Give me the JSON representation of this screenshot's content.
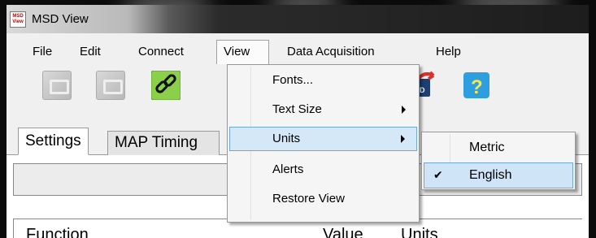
{
  "window": {
    "title": "MSD View",
    "app_icon_text": "MSD View"
  },
  "menubar": [
    "File",
    "Edit",
    "Connect",
    "View",
    "Data Acquisition",
    "Help"
  ],
  "toolbar": {
    "buttons": [
      {
        "icon": "disabled-import-icon",
        "enabled": false
      },
      {
        "icon": "disabled-export-icon",
        "enabled": false
      },
      {
        "icon": "connect-link-icon",
        "enabled": true
      },
      {
        "icon": "msd-send-icon",
        "enabled": true
      },
      {
        "icon": "help-question-icon",
        "enabled": true
      }
    ],
    "msd_badge": "SD",
    "help_glyph": "?"
  },
  "tabs": [
    "Settings",
    "MAP Timing"
  ],
  "grid_columns": [
    "Function",
    "Value",
    "Units"
  ],
  "view_menu": [
    {
      "label": "Fonts...",
      "submenu": false
    },
    {
      "label": "Text Size",
      "submenu": true
    },
    {
      "label": "Units",
      "submenu": true,
      "highlighted": true
    },
    {
      "label": "Alerts",
      "submenu": false
    },
    {
      "label": "Restore View",
      "submenu": false
    }
  ],
  "units_menu": [
    {
      "label": "Metric",
      "checked": false
    },
    {
      "label": "English",
      "checked": true,
      "highlighted": true
    }
  ],
  "colors": {
    "highlight_bg": "#d5e8f7",
    "highlight_border": "#6fa7d9",
    "menu_bg": "#f5f5f5"
  }
}
